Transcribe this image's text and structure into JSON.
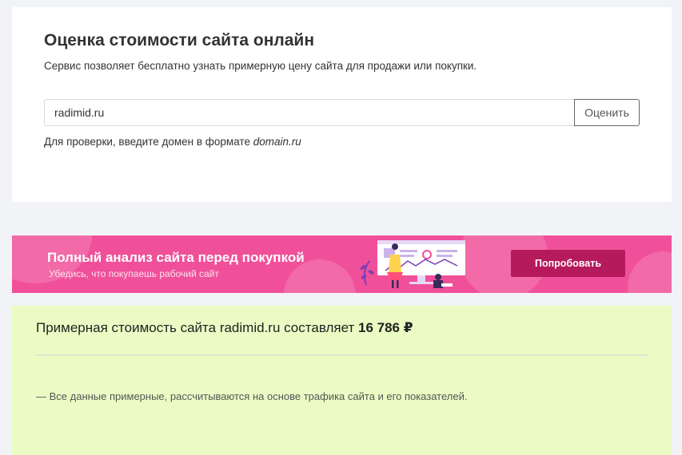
{
  "estimator": {
    "title": "Оценка стоимости сайта онлайн",
    "description": "Сервис позволяет бесплатно узнать примерную цену сайта для продажи или покупки.",
    "input_value": "radimid.ru",
    "button_label": "Оценить",
    "hint_prefix": "Для проверки, введите домен в формате ",
    "hint_example": "domain.ru"
  },
  "banner": {
    "title": "Полный анализ сайта перед покупкой",
    "subtitle": "Убедись, что покупаешь рабочий сайт",
    "button_label": "Попробовать",
    "colors": {
      "background": "#f0509a",
      "button": "#b51a5c"
    }
  },
  "result": {
    "text_prefix": "Примерная стоимость сайта radimid.ru составляет ",
    "price": "16 786 ₽",
    "note": "— Все данные примерные, рассчитываются на основе трафика сайта и его показателей."
  }
}
